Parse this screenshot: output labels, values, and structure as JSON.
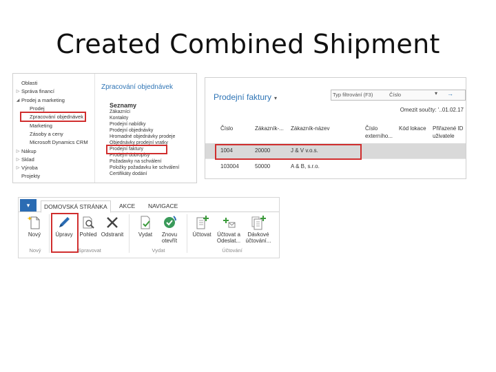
{
  "slide_title": "Created Combined Shipment",
  "nav": {
    "left_items": [
      {
        "label": "Oblasti",
        "arrow": ""
      },
      {
        "label": "Správa financí",
        "arrow": "▷"
      },
      {
        "label": "Prodej a marketing",
        "arrow": "◢"
      },
      {
        "label": "Prodej",
        "arrow": ""
      },
      {
        "label": "Zpracování objednávek",
        "arrow": ""
      },
      {
        "label": "Marketing",
        "arrow": ""
      },
      {
        "label": "Zásoby a ceny",
        "arrow": ""
      },
      {
        "label": "Microsoft Dynamics CRM",
        "arrow": ""
      },
      {
        "label": "Nákup",
        "arrow": "▷"
      },
      {
        "label": "Sklad",
        "arrow": "▷"
      },
      {
        "label": "Výroba",
        "arrow": "▷"
      },
      {
        "label": "Projekty",
        "arrow": ""
      }
    ],
    "right_title": "Zpracování objednávek",
    "right_heading": "Seznamy",
    "right_items": [
      "Zákazníci",
      "Kontakty",
      "Prodejní nabídky",
      "Prodejní objednávky",
      "Hromadné objednávky prodeje",
      "Objednávky prodejní vratky",
      "Prodejní faktury",
      "Prodejní dobropisy",
      "Požadavky na schválení",
      "Položky požadavku ke schválení",
      "Certifikáty dodání"
    ]
  },
  "list": {
    "title": "Prodejní faktury",
    "filter_placeholder": "Typ filtrování (F3)",
    "filter_field": "Číslo",
    "omezit": "Omezit součty: '..01.02.17",
    "columns": [
      "Číslo",
      "Zákazník-...",
      "Zákazník-název",
      "Číslo externího...",
      "Kód lokace",
      "Přiřazené ID uživatele"
    ],
    "rows": [
      {
        "cislo": "1004",
        "zakaznik": "20000",
        "nazev": "J & V v.o.s."
      },
      {
        "cislo": "103004",
        "zakaznik": "50000",
        "nazev": "A & B, s.r.o."
      }
    ]
  },
  "ribbon": {
    "tabs": [
      "DOMOVSKÁ STRÁNKA",
      "AKCE",
      "NAVIGACE"
    ],
    "buttons": [
      {
        "label": "Nový",
        "icon": "new-icon"
      },
      {
        "label": "Úpravy",
        "icon": "edit-pencil-icon"
      },
      {
        "label": "Pohled",
        "icon": "view-magnifier-icon"
      },
      {
        "label": "Odstranit",
        "icon": "delete-x-icon"
      },
      {
        "label": "Vydat",
        "icon": "release-icon"
      },
      {
        "label": "Znovu otevřít",
        "icon": "reopen-icon"
      },
      {
        "label": "Účtovat",
        "icon": "post-icon"
      },
      {
        "label": "Účtovat a Odeslat...",
        "icon": "post-and-send-icon"
      },
      {
        "label": "Dávkové účtování...",
        "icon": "batch-post-icon"
      }
    ],
    "groups": [
      "Nový",
      "Spravovat",
      "Vydat",
      "Účtování"
    ]
  },
  "colors": {
    "accent": "#2e74b5",
    "highlight": "#d02d2d",
    "file_tab": "#2b6cb3"
  }
}
